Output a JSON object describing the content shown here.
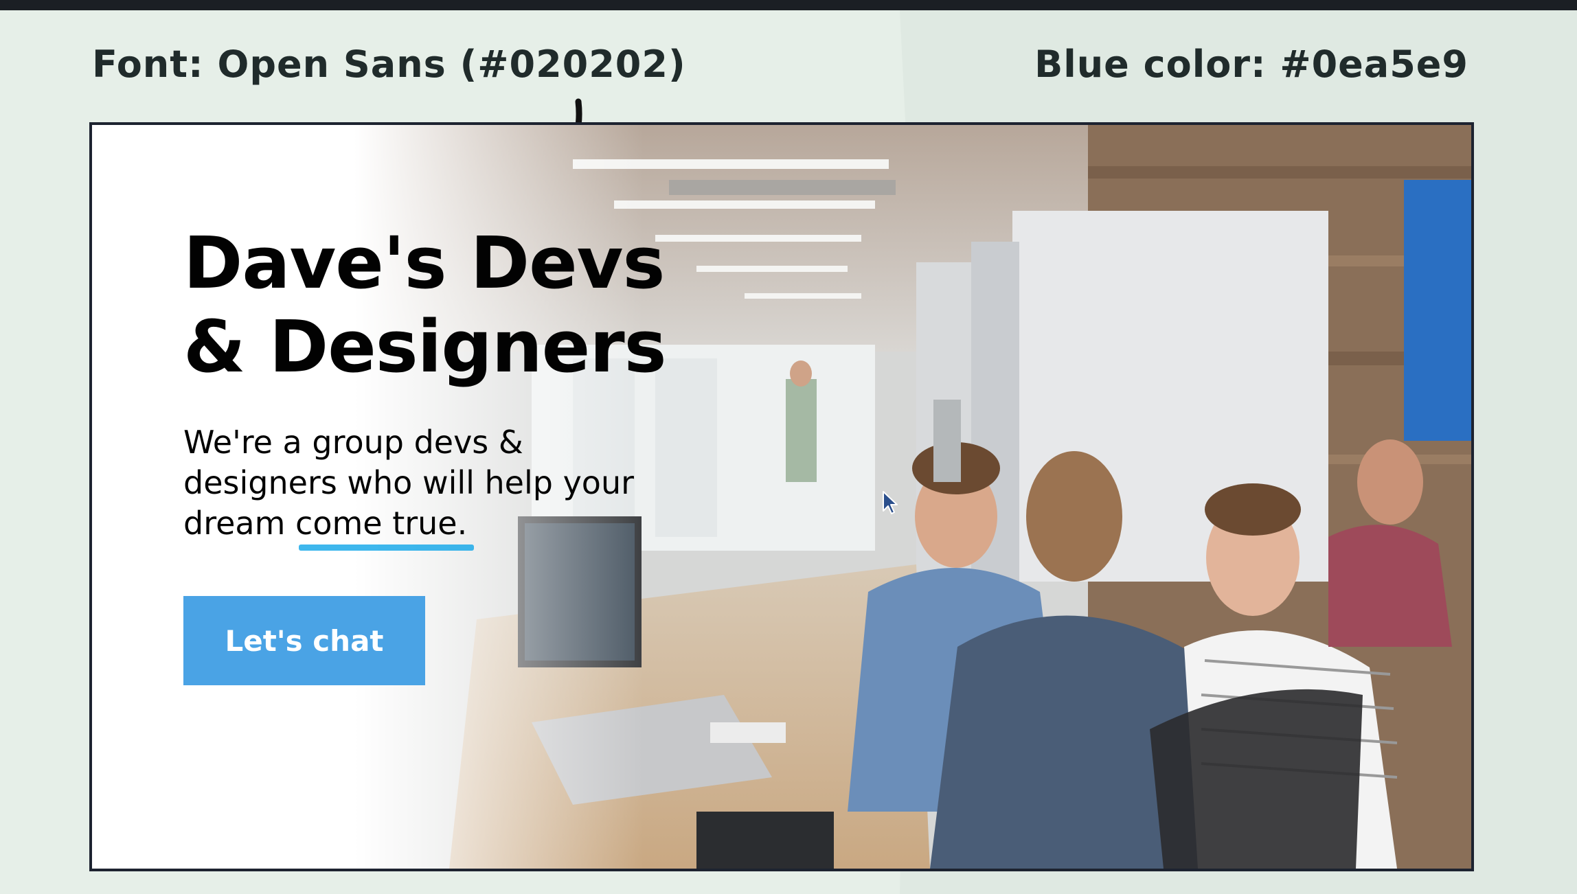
{
  "annotations": {
    "font_note": "Font: Open Sans (#020202)",
    "blue_note": "Blue color: #0ea5e9"
  },
  "hero": {
    "headline_line1": "Dave's Devs",
    "headline_line2": "& Designers",
    "subtitle_line1": "We're a group devs &",
    "subtitle_line2": "designers who will help your",
    "subtitle_line3": "dream come true.",
    "cta_label": "Let's chat"
  },
  "colors": {
    "text": "#020202",
    "accent_blue": "#0ea5e9",
    "button": "#4aa3e5",
    "frame_border": "#1d2330",
    "page_bg": "#e6efe8"
  },
  "icons": [
    "curved-arrow-icon",
    "mouse-cursor-icon"
  ]
}
